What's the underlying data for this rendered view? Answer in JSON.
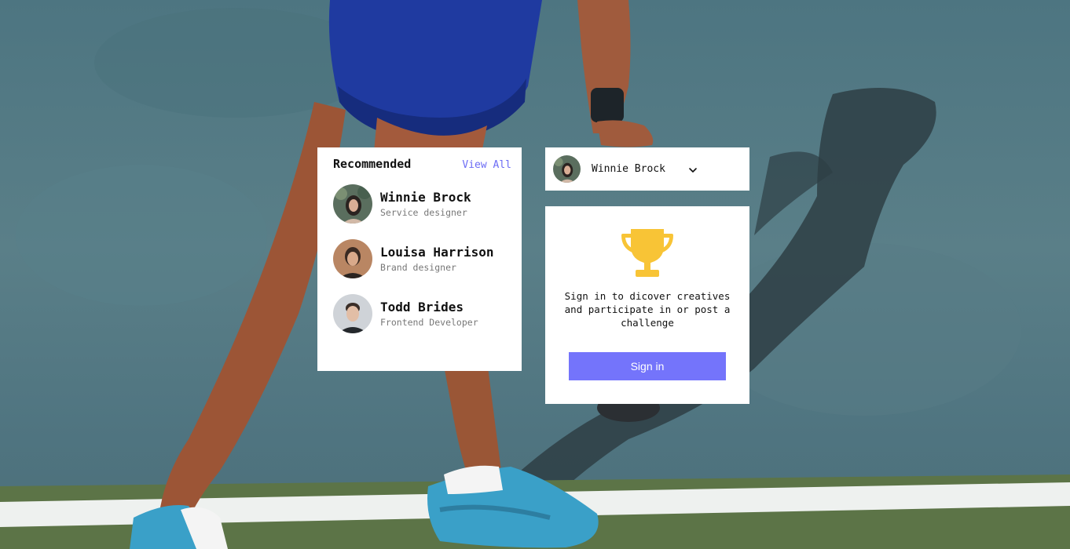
{
  "recommended": {
    "title": "Recommended",
    "view_all": "View All",
    "items": [
      {
        "name": "Winnie Brock",
        "role": "Service designer"
      },
      {
        "name": "Louisa Harrison",
        "role": "Brand designer"
      },
      {
        "name": "Todd Brides",
        "role": "Frontend Developer"
      }
    ]
  },
  "user_menu": {
    "name": "Winnie Brock"
  },
  "signin": {
    "message": "Sign in to dicover creatives and participate in or post a challenge",
    "button_label": "Sign in"
  },
  "icons": {
    "trophy": "trophy-icon",
    "chevron": "chevron-down-icon"
  },
  "colors": {
    "accent": "#6c6cf5",
    "button": "#7474fb",
    "trophy": "#f8c436"
  }
}
